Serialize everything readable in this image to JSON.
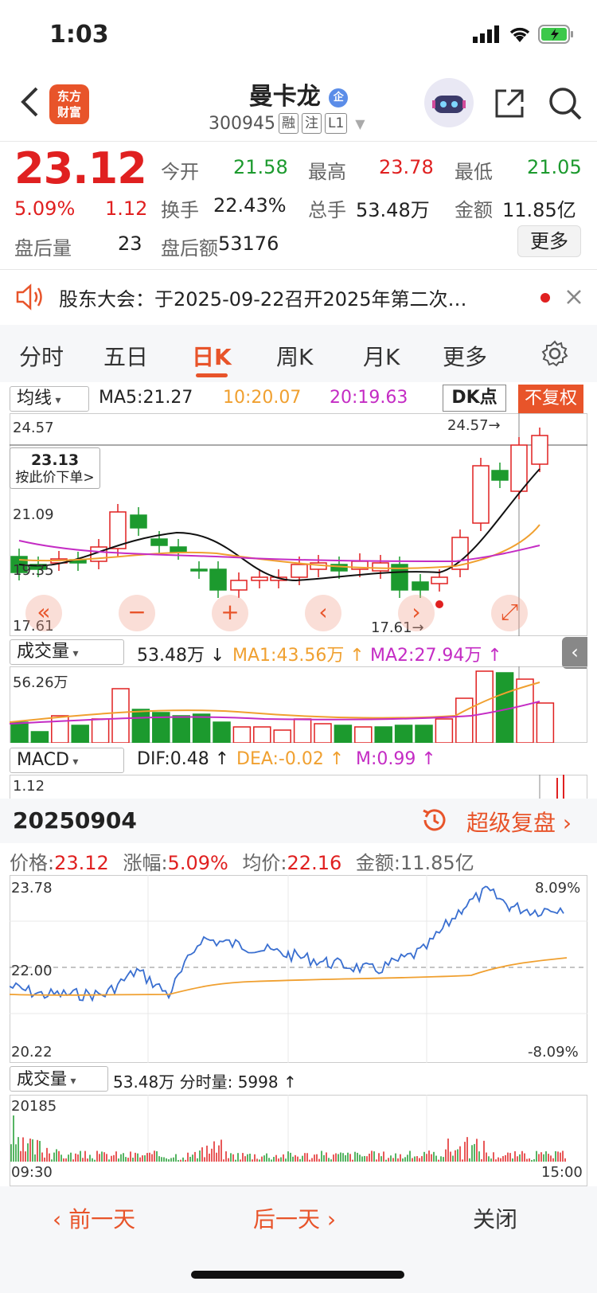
{
  "status_bar": {
    "time": "1:03"
  },
  "header": {
    "logo_text": "东方财富",
    "title": "曼卡龙",
    "title_badge": "企",
    "code": "300945",
    "tags": [
      "融",
      "注",
      "L1"
    ]
  },
  "quote": {
    "price": "23.12",
    "change_pct": "5.09%",
    "change": "1.12",
    "after_hours_volume_label": "盘后量",
    "after_hours_volume": "23",
    "open_label": "今开",
    "open": "21.58",
    "high_label": "最高",
    "high": "23.78",
    "low_label": "最低",
    "low": "21.05",
    "turnover_label": "换手",
    "turnover": "22.43%",
    "total_hands_label": "总手",
    "total_hands": "53.48万",
    "amount_label": "金额",
    "amount": "11.85亿",
    "after_hours_amount_label": "盘后额",
    "after_hours_amount": "53176",
    "more_label": "更多"
  },
  "notice": {
    "text": "股东大会：于2025-09-22召开2025年第二次…"
  },
  "tabs": [
    "分时",
    "五日",
    "日K",
    "周K",
    "月K",
    "更多"
  ],
  "kline": {
    "ma_select": "均线",
    "ma5": "MA5:21.27",
    "ma10": "10:20.07",
    "ma20": "20:19.63",
    "dk_label": "DK点",
    "fq_label": "不复权",
    "y_labels": [
      "24.57",
      "21.09",
      "19.35",
      "17.61"
    ],
    "high_marker": "24.57",
    "low_marker": "17.61",
    "price_tag": "23.13",
    "price_tag_sub": "按此价下单>"
  },
  "volume": {
    "select": "成交量",
    "total": "53.48万",
    "ma1": "MA1:43.56万",
    "ma2": "MA2:27.94万",
    "y_top": "56.26万"
  },
  "macd": {
    "select": "MACD",
    "dif": "DIF:0.48",
    "dea": "DEA:-0.02",
    "m": "M:0.99",
    "y_top": "1.12"
  },
  "intraday": {
    "date": "20250904",
    "replay_label": "超级复盘",
    "price_label": "价格:",
    "price": "23.12",
    "chg_label": "涨幅:",
    "chg": "5.09%",
    "avg_label": "均价:",
    "avg": "22.16",
    "amt_label": "金额:",
    "amt": "11.85亿",
    "y_top": "23.78",
    "y_mid": "22.00",
    "y_bottom": "20.22",
    "pct_top": "8.09%",
    "pct_bottom": "-8.09%",
    "vol_select": "成交量",
    "vol_text": "53.48万 分时量: 5998",
    "vol_top": "20185",
    "time_start": "09:30",
    "time_end": "15:00"
  },
  "bottom_nav": {
    "prev": "前一天",
    "next": "后一天",
    "close": "关闭"
  },
  "colors": {
    "up": "#e02020",
    "down": "#1c9a2e",
    "accent": "#e8542a",
    "ma10": "#f0a030",
    "ma20": "#c42cc4"
  }
}
